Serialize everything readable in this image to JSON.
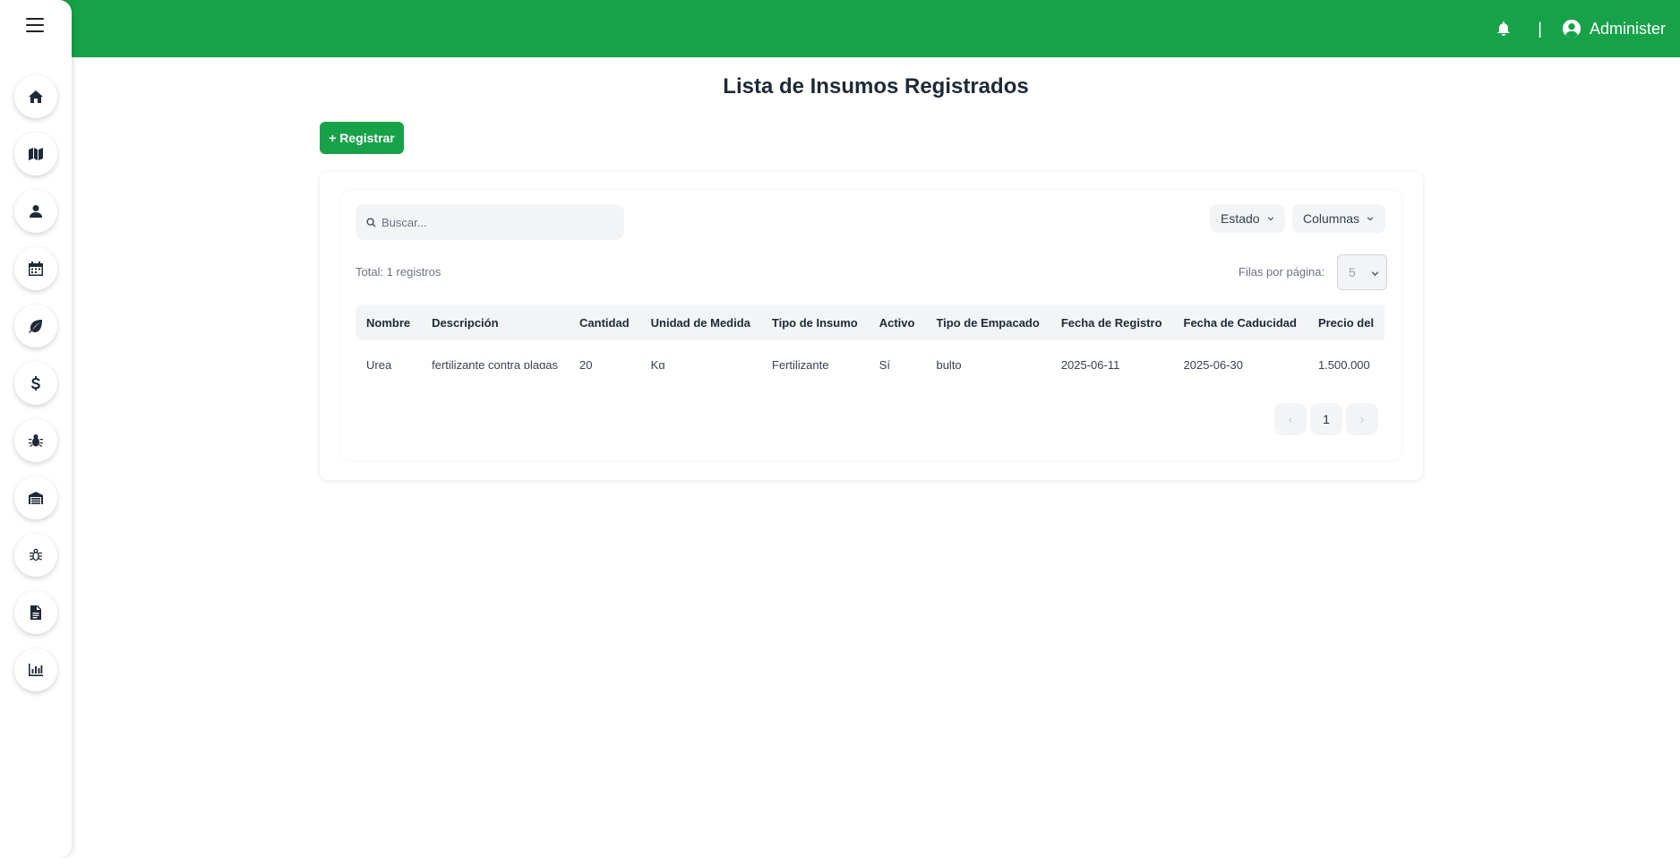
{
  "header": {
    "username": "Administer"
  },
  "sidebar": {
    "items": [
      {
        "icon": "home-icon"
      },
      {
        "icon": "map-icon"
      },
      {
        "icon": "user-icon"
      },
      {
        "icon": "calendar-icon"
      },
      {
        "icon": "leaf-icon"
      },
      {
        "icon": "dollar-icon"
      },
      {
        "icon": "bug-icon"
      },
      {
        "icon": "warehouse-icon"
      },
      {
        "icon": "pest-icon"
      },
      {
        "icon": "document-icon"
      },
      {
        "icon": "chart-icon"
      }
    ]
  },
  "page": {
    "title": "Lista de Insumos Registrados",
    "register_label": "+ Registrar"
  },
  "table_controls": {
    "search_placeholder": "Buscar...",
    "estado_label": "Estado",
    "columnas_label": "Columnas",
    "total_text": "Total: 1 registros",
    "rows_per_page_label": "Filas por página:",
    "rows_per_page_value": "5"
  },
  "table": {
    "headers": [
      "Nombre",
      "Descripción",
      "Cantidad",
      "Unidad de Medida",
      "Tipo de Insumo",
      "Activo",
      "Tipo de Empacado",
      "Fecha de Registro",
      "Fecha de Caducidad",
      "Precio del"
    ],
    "rows": [
      [
        "Urea",
        "fertilizante contra plagas",
        "20",
        "Kg",
        "Fertilizante",
        "Sí",
        "bulto",
        "2025-06-11",
        "2025-06-30",
        "1.500.000"
      ]
    ]
  },
  "pagination": {
    "prev": "‹",
    "current_page": "1",
    "next": "›"
  },
  "colors": {
    "brand": "#17a24a"
  }
}
